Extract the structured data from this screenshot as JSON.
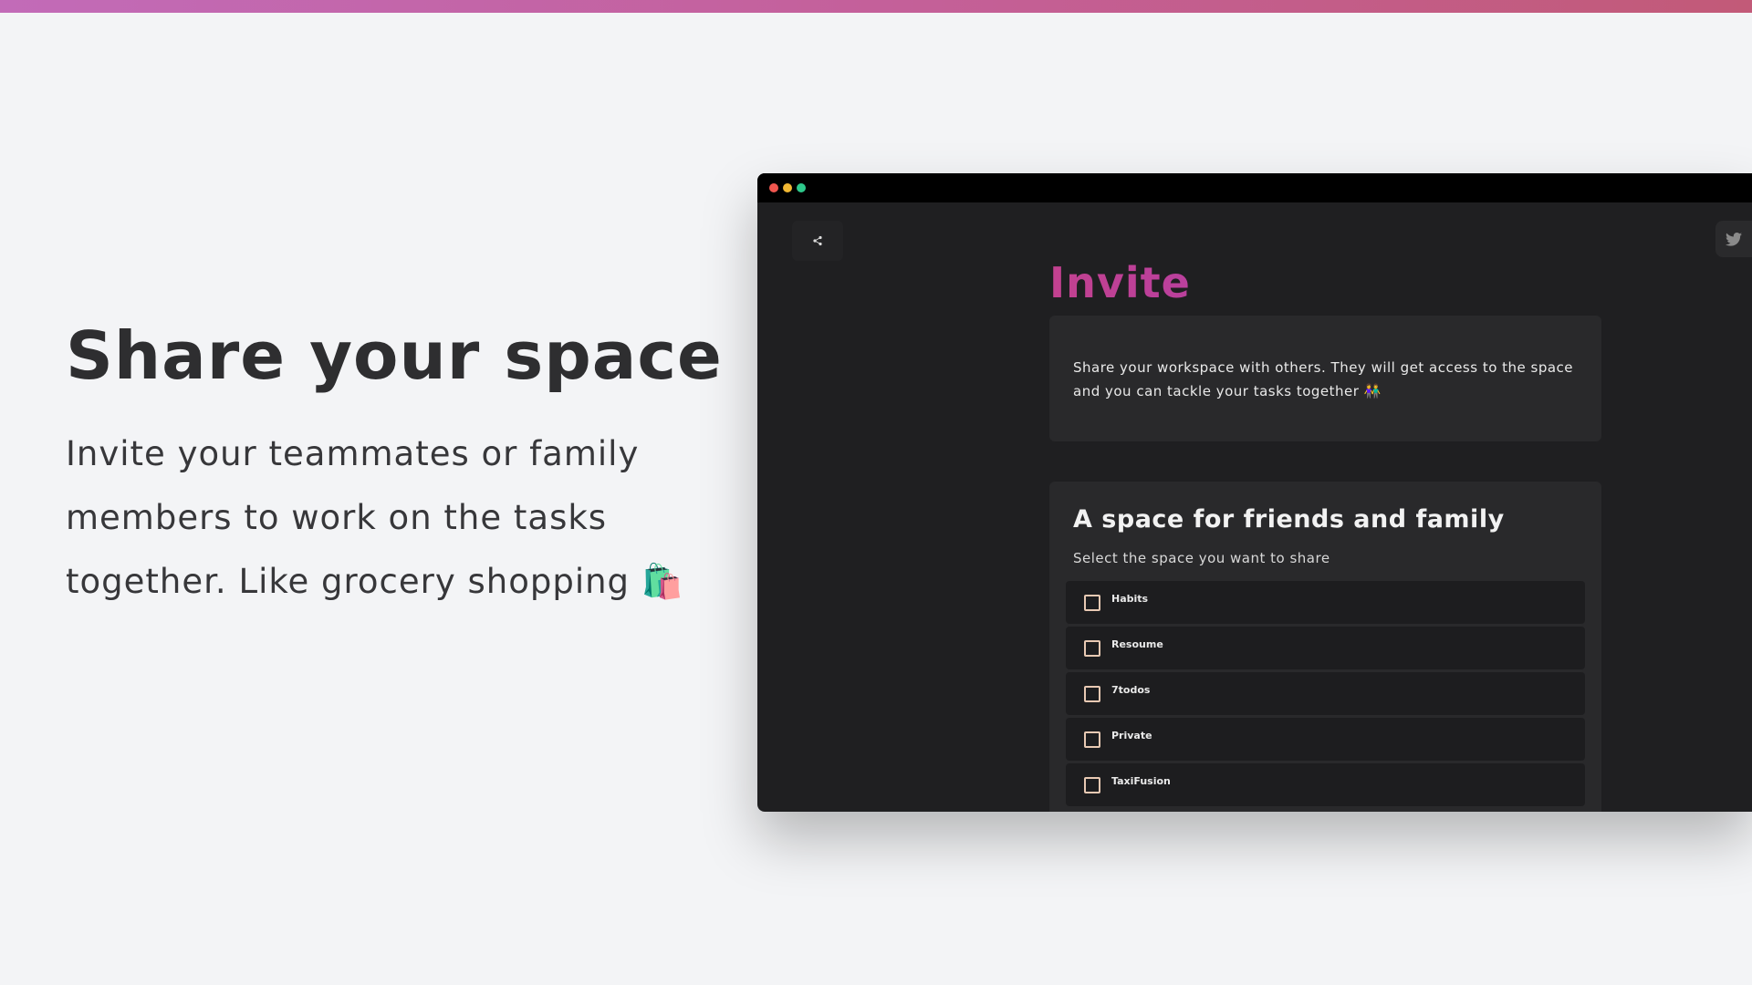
{
  "hero": {
    "title": "Share your space",
    "subtitle": "Invite your teammates or family members to work on the tasks together. Like grocery shopping 🛍️"
  },
  "window": {
    "share_icon": "share-icon",
    "twitter_icon": "twitter-icon",
    "invite_title": "Invite",
    "info_text": "Share your workspace with others. They will get access to the space and you can tackle your tasks together 👫",
    "space_title": "A space for friends and family",
    "space_subtitle": "Select the space you want to share",
    "spaces": [
      {
        "label": "Habits"
      },
      {
        "label": "Resoume"
      },
      {
        "label": "7todos"
      },
      {
        "label": "Private"
      },
      {
        "label": "TaxiFusion"
      }
    ]
  },
  "colors": {
    "accent_start": "#c2418f",
    "accent_end": "#a23ec6",
    "checkbox_border": "#e8c9b3"
  }
}
